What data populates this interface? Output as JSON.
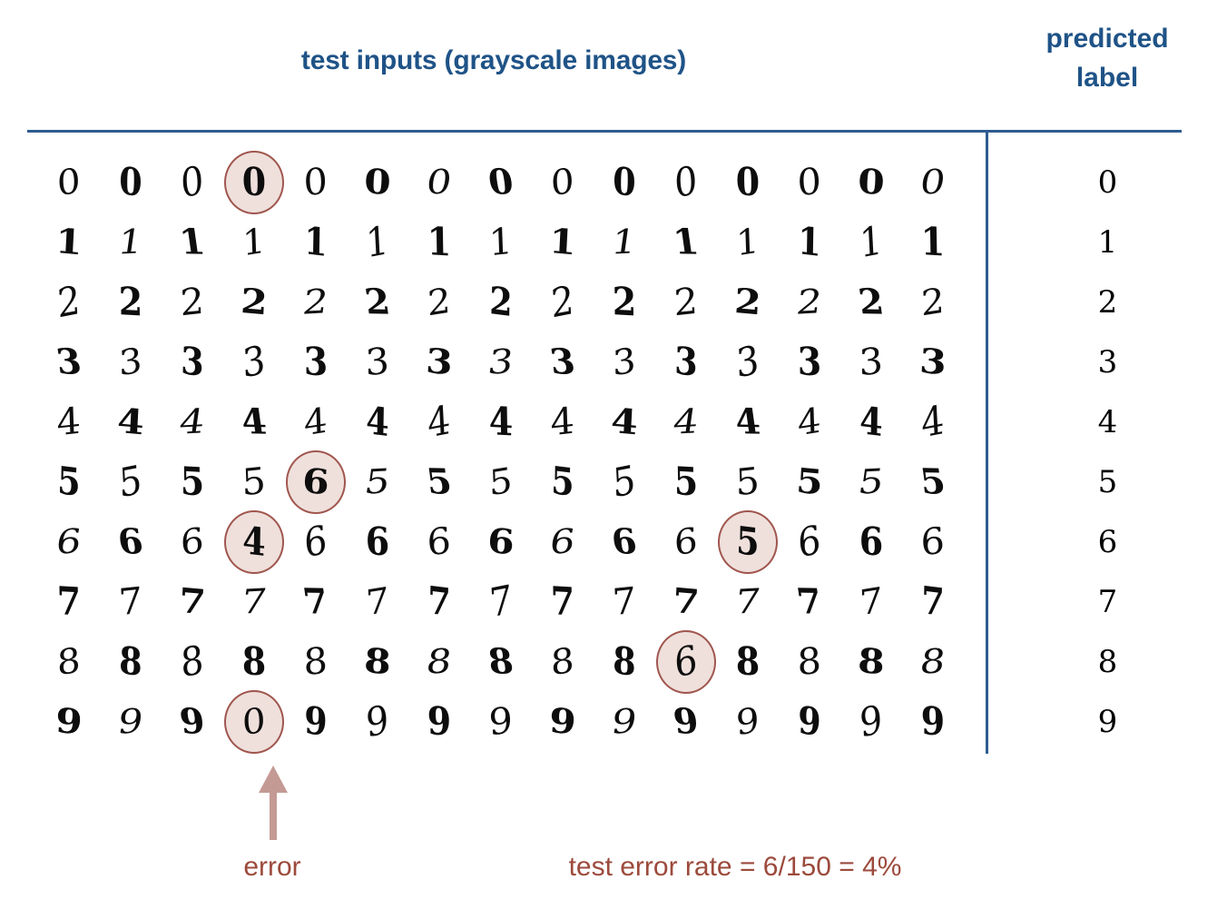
{
  "headers": {
    "inputs_title": "test inputs (grayscale images)",
    "predicted_line1": "predicted",
    "predicted_line2": "label"
  },
  "colors": {
    "heading_blue": "#1F5387",
    "rule_blue": "#2E5C91",
    "error_circle_fill": "#EFE0DC",
    "error_circle_stroke": "#A0564E",
    "arrow": "#C49A94",
    "caption_red": "#9C4A3C",
    "digit_ink": "#0d0d0d"
  },
  "grid": {
    "rows": 10,
    "columns": 15,
    "row_digits": [
      [
        "0",
        "0",
        "0",
        "0",
        "0",
        "0",
        "0",
        "0",
        "0",
        "0",
        "0",
        "0",
        "0",
        "0",
        "0"
      ],
      [
        "1",
        "1",
        "1",
        "1",
        "1",
        "1",
        "1",
        "1",
        "1",
        "1",
        "1",
        "1",
        "1",
        "1",
        "1"
      ],
      [
        "2",
        "2",
        "2",
        "2",
        "2",
        "2",
        "2",
        "2",
        "2",
        "2",
        "2",
        "2",
        "2",
        "2",
        "2"
      ],
      [
        "3",
        "3",
        "3",
        "3",
        "3",
        "3",
        "3",
        "3",
        "3",
        "3",
        "3",
        "3",
        "3",
        "3",
        "3"
      ],
      [
        "4",
        "4",
        "4",
        "4",
        "4",
        "4",
        "4",
        "4",
        "4",
        "4",
        "4",
        "4",
        "4",
        "4",
        "4"
      ],
      [
        "5",
        "5",
        "5",
        "5",
        "6",
        "5",
        "5",
        "5",
        "5",
        "5",
        "5",
        "5",
        "5",
        "5",
        "5"
      ],
      [
        "6",
        "6",
        "6",
        "4",
        "6",
        "6",
        "6",
        "6",
        "6",
        "6",
        "6",
        "5",
        "6",
        "6",
        "6"
      ],
      [
        "7",
        "7",
        "7",
        "7",
        "7",
        "7",
        "7",
        "7",
        "7",
        "7",
        "7",
        "7",
        "7",
        "7",
        "7"
      ],
      [
        "8",
        "8",
        "8",
        "8",
        "8",
        "8",
        "8",
        "8",
        "8",
        "8",
        "6",
        "8",
        "8",
        "8",
        "8"
      ],
      [
        "9",
        "9",
        "9",
        "0",
        "9",
        "9",
        "9",
        "9",
        "9",
        "9",
        "9",
        "9",
        "9",
        "9",
        "9"
      ]
    ],
    "errors": [
      {
        "row": 0,
        "col": 3,
        "shown_digit": "0"
      },
      {
        "row": 5,
        "col": 4,
        "shown_digit": "6"
      },
      {
        "row": 6,
        "col": 3,
        "shown_digit": "4"
      },
      {
        "row": 6,
        "col": 11,
        "shown_digit": "5"
      },
      {
        "row": 8,
        "col": 10,
        "shown_digit": "6"
      },
      {
        "row": 9,
        "col": 3,
        "shown_digit": "0"
      }
    ]
  },
  "predicted_labels": [
    "0",
    "1",
    "2",
    "3",
    "4",
    "5",
    "6",
    "7",
    "8",
    "9"
  ],
  "footer": {
    "error_label": "error",
    "error_rate_text": "test error rate = 6/150 = 4%"
  },
  "stats": {
    "error_count": 6,
    "total_samples": 150,
    "error_rate_percent": 4
  }
}
